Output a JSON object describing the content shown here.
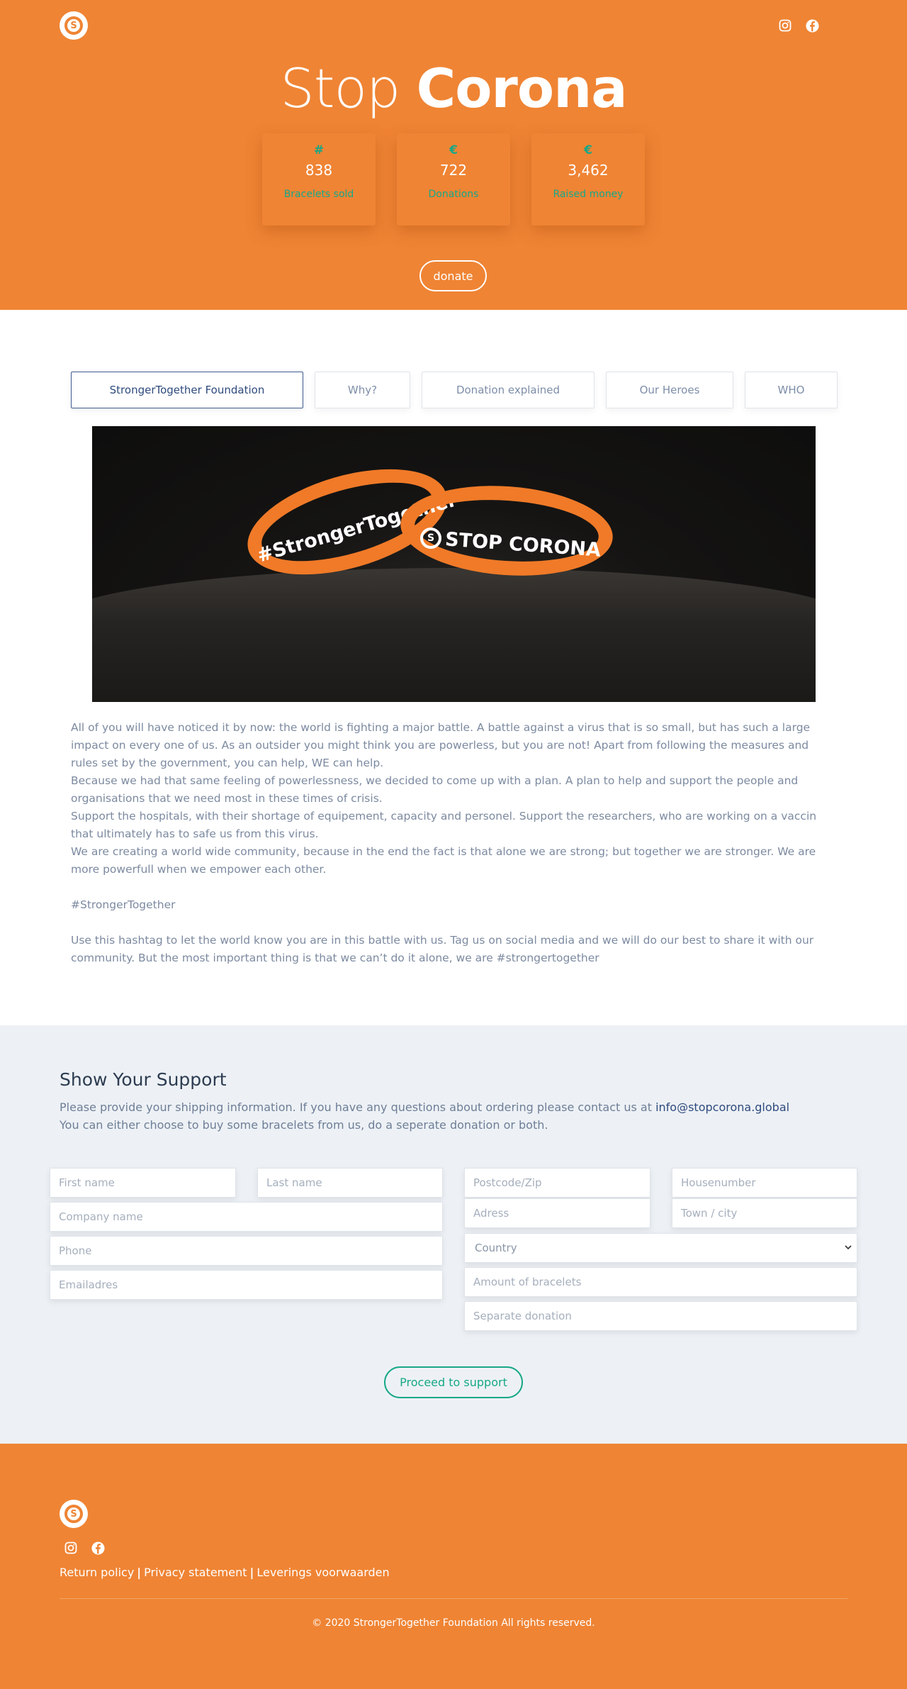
{
  "header": {
    "logo_letter": "S",
    "social": [
      "instagram-icon",
      "facebook-icon"
    ],
    "title_light": "Stop",
    "title_bold": "Corona",
    "stats": [
      {
        "symbol": "#",
        "value": "838",
        "label": "Bracelets sold"
      },
      {
        "symbol": "€",
        "value": "722",
        "label": "Donations"
      },
      {
        "symbol": "€",
        "value": "3,462",
        "label": "Raised money"
      }
    ],
    "donate_label": "donate"
  },
  "tabs": [
    {
      "label": "StrongerTogether Foundation",
      "active": true
    },
    {
      "label": "Why?"
    },
    {
      "label": "Donation explained"
    },
    {
      "label": "Our Heroes"
    },
    {
      "label": "WHO"
    }
  ],
  "photo": {
    "band_left_text": "#StrongerTogether",
    "band_right_text": "STOP CORONA",
    "band_right_logo": "S"
  },
  "article": {
    "p1": "All of you will have noticed it by now: the world is fighting a major battle. A battle against a virus that is so small, but has such a large impact on every one of us. As an outsider you might think you are powerless, but you are not! Apart from following the measures and rules set by the government, you can help, WE can help.",
    "p2": "Because we had that same feeling of powerlessness, we decided to come up with a plan. A plan to help and support the people and organisations that we need most in these times of crisis.",
    "p3": "Support the hospitals, with their shortage of equipement, capacity and personel. Support the researchers, who are working on a vaccin that ultimately has to safe us from this virus.",
    "p4": "We are creating a world wide community, because in the end the fact is that alone we are strong; but together we are stronger. We are more powerfull when we empower each other.",
    "hashtag": "#StrongerTogether",
    "p5": "Use this hashtag to let the world know you are in this battle with us. Tag us on social media and we will do our best to share it with our community. But the most important thing is that we can’t do it alone, we are #strongertogether"
  },
  "support": {
    "title": "Show Your Support",
    "intro_line1": "Please provide your shipping information. If you have any questions about ordering please contact us at ",
    "email": "info@stopcorona.global",
    "intro_line2": "You can either choose to buy some bracelets from us, do a seperate donation or both.",
    "fields": {
      "first_name": "First name",
      "last_name": "Last name",
      "company": "Company name",
      "phone": "Phone",
      "email": "Emailadres",
      "postcode": "Postcode/Zip",
      "housenumber": "Housenumber",
      "address": "Adress",
      "town": "Town / city",
      "country": "Country",
      "bracelets": "Amount of bracelets",
      "donation": "Separate donation"
    },
    "proceed_label": "Proceed to support"
  },
  "footer": {
    "logo_letter": "S",
    "social": [
      "instagram-icon",
      "facebook-icon"
    ],
    "links": [
      "Return policy",
      "Privacy statement",
      "Leverings voorwaarden"
    ],
    "separator": "|",
    "copyright": "© 2020 StrongerTogether Foundation All rights reserved."
  },
  "colors": {
    "brand_orange": "#ef8434",
    "accent_green": "#18a887",
    "navy": "#2e4a7d"
  }
}
